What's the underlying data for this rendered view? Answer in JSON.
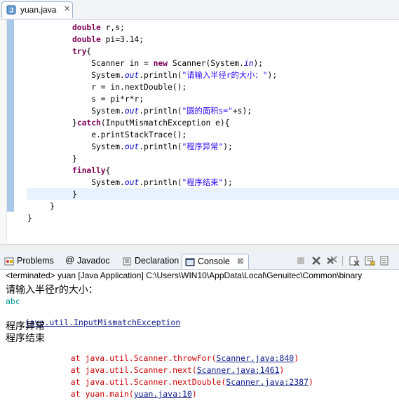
{
  "editor": {
    "tab_label": "yuan.java",
    "tab_close": "✕",
    "lines": [
      [
        [
          "kw",
          "double"
        ],
        [
          "t",
          " r,s;"
        ]
      ],
      [
        [
          "kw",
          "double"
        ],
        [
          "t",
          " pi=3.14;"
        ]
      ],
      [
        [
          "kw",
          "try"
        ],
        [
          "t",
          "{"
        ]
      ],
      [
        [
          "t",
          "    Scanner in = "
        ],
        [
          "kw",
          "new"
        ],
        [
          "t",
          " Scanner(System."
        ],
        [
          "it",
          "in"
        ],
        [
          "t",
          ");"
        ]
      ],
      [
        [
          "t",
          "    System."
        ],
        [
          "it",
          "out"
        ],
        [
          "t",
          ".println("
        ],
        [
          "str",
          "\"请输入半径r的大小：\""
        ],
        [
          "t",
          ");"
        ]
      ],
      [
        [
          "t",
          "    r = in.nextDouble();"
        ]
      ],
      [
        [
          "t",
          "    s = pi*r*r;"
        ]
      ],
      [
        [
          "t",
          "    System."
        ],
        [
          "it",
          "out"
        ],
        [
          "t",
          ".println("
        ],
        [
          "str",
          "\"圆的面积s=\""
        ],
        [
          "t",
          "+s);"
        ]
      ],
      [
        [
          "t",
          "}"
        ],
        [
          "kw",
          "catch"
        ],
        [
          "t",
          "(InputMismatchException e){"
        ]
      ],
      [
        [
          "t",
          "    e.printStackTrace();"
        ]
      ],
      [
        [
          "t",
          "    System."
        ],
        [
          "it",
          "out"
        ],
        [
          "t",
          ".println("
        ],
        [
          "str",
          "\"程序异常\""
        ],
        [
          "t",
          ");"
        ]
      ],
      [
        [
          "t",
          "}"
        ]
      ],
      [
        [
          "kw",
          "finally"
        ],
        [
          "t",
          "{"
        ]
      ],
      [
        [
          "t",
          "    System."
        ],
        [
          "it",
          "out"
        ],
        [
          "t",
          ".println("
        ],
        [
          "str",
          "\"程序结束\""
        ],
        [
          "t",
          ");"
        ]
      ],
      [
        [
          "t",
          "}"
        ]
      ],
      [
        [
          "t",
          "}"
        ]
      ],
      [
        [
          "t",
          "}"
        ]
      ]
    ]
  },
  "views": {
    "tabs": [
      {
        "label": "Problems",
        "icon": "problems-icon"
      },
      {
        "label": "Javadoc",
        "icon": "javadoc-icon"
      },
      {
        "label": "Declaration",
        "icon": "declaration-icon"
      },
      {
        "label": "Console",
        "icon": "console-icon",
        "active": true,
        "suffix": "⊠"
      }
    ]
  },
  "console": {
    "status": "<terminated> yuan [Java Application] C:\\Users\\WIN10\\AppData\\Local\\Genuitec\\Common\\binary",
    "prompt": "请输入半径r的大小：",
    "input": "abc",
    "exception": "java.util.InputMismatchException",
    "out1": "程序异常",
    "out2": "程序结束",
    "stack": [
      {
        "prefix": "at java.util.Scanner.throwFor(",
        "link": "Scanner.java:840",
        "suffix": ")"
      },
      {
        "prefix": "at java.util.Scanner.next(",
        "link": "Scanner.java:1461",
        "suffix": ")"
      },
      {
        "prefix": "at java.util.Scanner.nextDouble(",
        "link": "Scanner.java:2387",
        "suffix": ")"
      },
      {
        "prefix": "at yuan.main(",
        "link": "yuan.java:10",
        "suffix": ")"
      }
    ]
  }
}
